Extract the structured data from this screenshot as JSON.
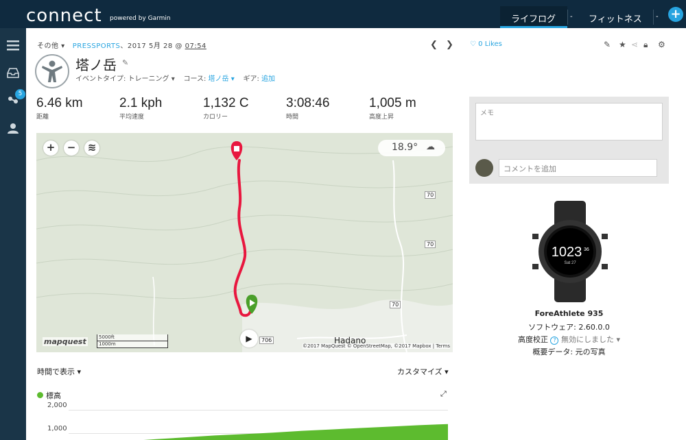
{
  "header": {
    "brand": "connect",
    "brand_sub": "powered by Garmin",
    "tabs": [
      {
        "label": "ライフログ"
      },
      {
        "label": "フィットネス"
      }
    ],
    "caret": "-",
    "plus": "+"
  },
  "sidebar": {
    "badge": "5"
  },
  "activity": {
    "crumb_prefix": "その他 ▾",
    "crumb_user": "PRESSPORTS",
    "crumb_date": "、2017 5月 28 @ ",
    "crumb_time": "07:54",
    "title": "塔ノ岳",
    "event_label": "イベントタイプ: トレーニング ▾",
    "course_label": "コース: ",
    "course_value": "塔ノ岳 ▾",
    "gear_label": "ギア: ",
    "gear_value": "追加"
  },
  "stats": [
    {
      "value": "6.46 km",
      "label": "距離"
    },
    {
      "value": "2.1 kph",
      "label": "平均速度"
    },
    {
      "value": "1,132 C",
      "label": "カロリー"
    },
    {
      "value": "3:08:46",
      "label": "時間"
    },
    {
      "value": "1,005 m",
      "label": "高度上昇"
    }
  ],
  "map": {
    "zoom_in": "+",
    "zoom_out": "−",
    "temperature": "18.9°",
    "mapquest": "mapquest",
    "scale_ft": "5000ft",
    "scale_m": "1000m",
    "place": "Hadano",
    "attribution": "©2017 MapQuest © OpenStreetMap, ©2017 Mapbox | Terms",
    "route_labels": [
      "70",
      "70",
      "70",
      "706"
    ]
  },
  "chart_controls": {
    "time_display": "時間で表示 ▾",
    "customize": "カスタマイズ ▾",
    "legend": "標高"
  },
  "chart_data": {
    "type": "area",
    "title": "",
    "series": [
      {
        "name": "標高",
        "color": "#5dbb2f",
        "values": [
          120,
          180,
          260,
          340,
          420,
          500,
          560,
          620,
          700,
          760,
          820,
          880,
          940,
          990
        ]
      }
    ],
    "yticks": [
      "2,000",
      "1,000"
    ],
    "ylim": [
      0,
      2000
    ],
    "grid": true
  },
  "side": {
    "likes": "0 Likes",
    "memo_placeholder": "メモ",
    "comment_placeholder": "コメントを追加",
    "device_name": "ForeAthlete 935",
    "software": "ソフトウェア: 2.60.0.0",
    "altitude_label": "高度校正 ",
    "altitude_value": " 無効にしました ▾",
    "summary": "概要データ: 元の写真",
    "watch_time": "1023",
    "watch_sec": "36",
    "watch_date": "Sat 27"
  },
  "colors": {
    "topbar": "#0f2a3f",
    "accent": "#27a4e0",
    "route": "#e8173f",
    "elevation": "#5dbb2f"
  }
}
